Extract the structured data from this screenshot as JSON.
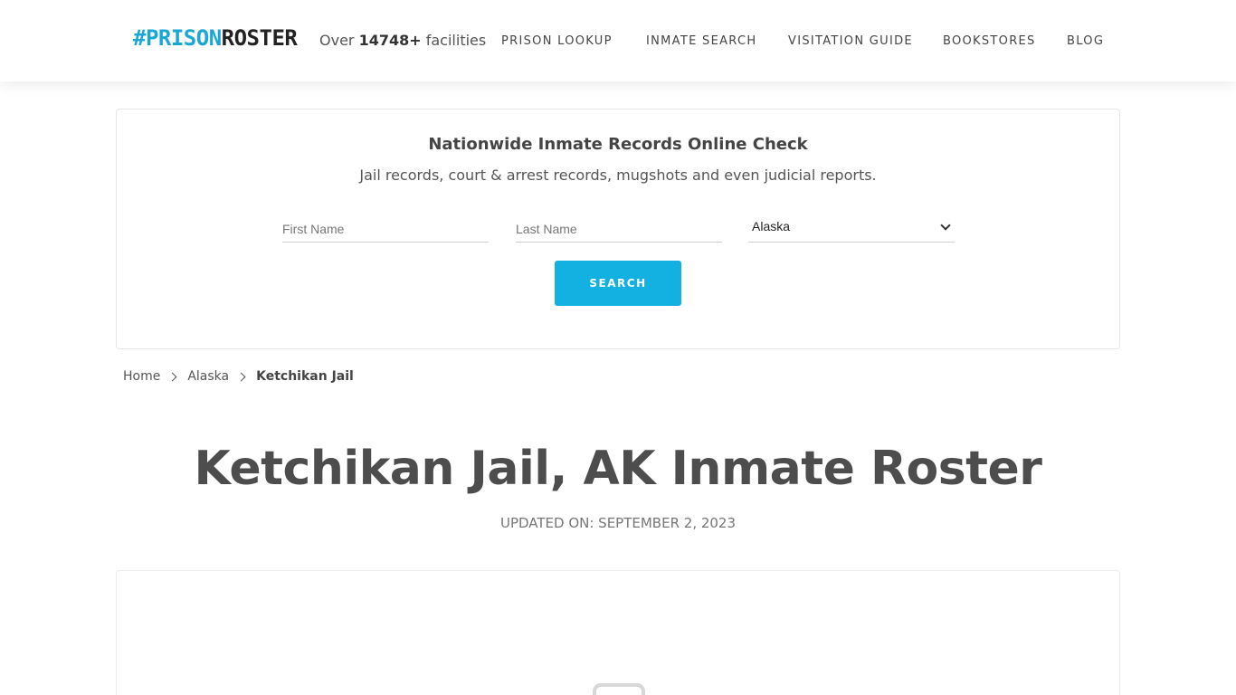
{
  "header": {
    "logo": {
      "hash": "#",
      "prison": "PRISON",
      "roster": "ROSTER"
    },
    "facilities": {
      "prefix": "Over ",
      "count": "14748+",
      "suffix": " facilities"
    },
    "nav": [
      {
        "label": "PRISON LOOKUP"
      },
      {
        "label": "INMATE SEARCH"
      },
      {
        "label": "VISITATION GUIDE"
      },
      {
        "label": "BOOKSTORES"
      },
      {
        "label": "BLOG"
      }
    ]
  },
  "search": {
    "title": "Nationwide Inmate Records Online Check",
    "subtitle": "Jail records, court & arrest records, mugshots and even judicial reports.",
    "first_name_placeholder": "First Name",
    "last_name_placeholder": "Last Name",
    "state_selected": "Alaska",
    "button_label": "SEARCH"
  },
  "breadcrumb": {
    "items": [
      {
        "label": "Home"
      },
      {
        "label": "Alaska"
      },
      {
        "label": "Ketchikan Jail"
      }
    ]
  },
  "page": {
    "title": "Ketchikan Jail, AK Inmate Roster",
    "updated": "UPDATED ON: SEPTEMBER 2, 2023"
  },
  "colors": {
    "accent": "#13b1e2",
    "logo_blue": "#1ba7d6",
    "text_dark": "#4d4d4d"
  }
}
